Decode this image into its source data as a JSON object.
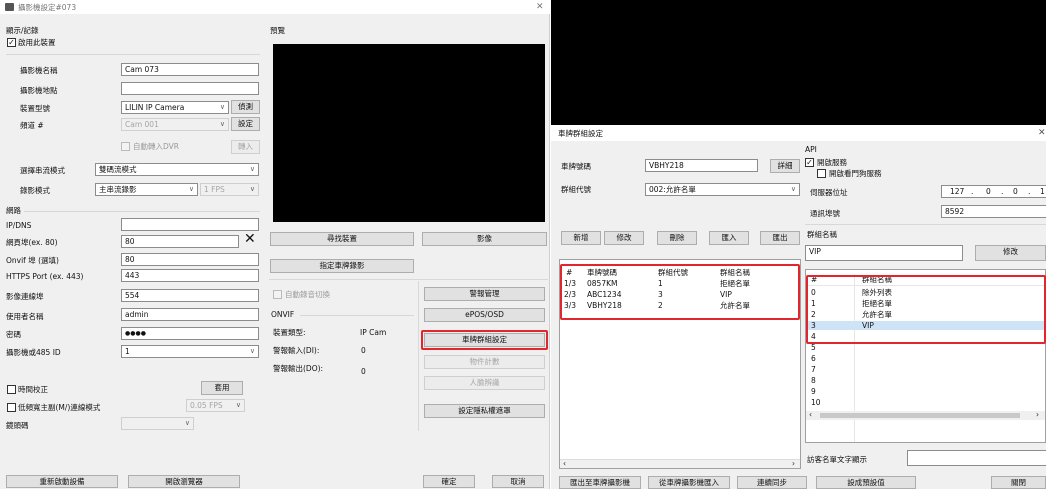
{
  "left_window": {
    "title": "攝影機設定#073",
    "display_record": {
      "group": "顯示/記錄",
      "enable_label": "啟用此裝置",
      "enable_checked": true
    },
    "fields": {
      "name_label": "攝影機名稱",
      "name_value": "Cam 073",
      "location_label": "攝影機地點",
      "location_value": "",
      "model_label": "裝置型號",
      "model_value": "LILIN IP Camera",
      "detect_button": "偵測",
      "channel_label": "頻道 #",
      "channel_value": "Cam 001",
      "setup_button": "設定",
      "auto_import_label": "自動轉入DVR",
      "import_button": "轉入",
      "stream_mode_label": "選擇串流模式",
      "stream_mode_value": "雙碼流模式",
      "record_mode_label": "錄影模式",
      "record_mode_value": "主串流錄影",
      "record_fps": "1 FPS"
    },
    "network": {
      "group": "網路",
      "ipdns_label": "IP/DNS",
      "ipdns_value": "",
      "webport_label": "網頁埠(ex. 80)",
      "webport_value": "80",
      "onvif_label": "Onvif 埠 (選填)",
      "onvif_value": "80",
      "https_label": "HTTPS Port (ex. 443)",
      "https_value": "443",
      "videoport_label": "影像連線埠",
      "videoport_value": "554",
      "user_label": "使用者名稱",
      "user_value": "admin",
      "pass_label": "密碼",
      "pass_value": "●●●●",
      "rs485_label": "攝影機或485 ID",
      "rs485_value": "1"
    },
    "bottom": {
      "time_sync_label": "時間校正",
      "apply_button": "套用",
      "low_bw_label": "低頻寬主副(M/)連線模式",
      "low_bw_fps": "0.05 FPS",
      "lens_label": "鏡頭碼",
      "lens_value": ""
    },
    "preview": {
      "group": "預覽",
      "find_device_button": "尋找裝置",
      "video_button": "影像",
      "set_plate_button": "指定車牌錄影"
    },
    "options": {
      "auto_record_switch": "自動錄音切換",
      "alarm_button": "警報管理",
      "onvif_label": "ONVIF",
      "epos_button": "ePOS/OSD",
      "device_type_label": "裝置類型:",
      "device_type_value": "IP Cam",
      "plate_group_button": "車牌群組設定",
      "alarm_in_label": "警報輸入(DI):",
      "alarm_in_value": "0",
      "counter_button": "物件計數",
      "alarm_out_label": "警報輸出(DO):",
      "alarm_out_value": "0",
      "face_button": "人臉辨識",
      "privacy_button": "設定隱私權遮罩"
    },
    "footer": {
      "restart_button": "重新啟動設備",
      "browser_button": "開啟瀏覽器",
      "ok_button": "確定",
      "cancel_button": "取消"
    }
  },
  "dialog": {
    "title": "車牌群組設定",
    "plate_label": "車牌號碼",
    "plate_value": "VBHY218",
    "detail_button": "詳細",
    "group_label": "群組代號",
    "group_value": "002:允許名單",
    "buttons": [
      "新增",
      "修改",
      "刪除",
      "匯入",
      "匯出"
    ],
    "table_headers": [
      "#",
      "車牌號碼",
      "群組代號",
      "群組名稱"
    ],
    "table_rows": [
      [
        "1/3",
        "0857KM",
        "1",
        "拒絕名單"
      ],
      [
        "2/3",
        "ABC1234",
        "3",
        "VIP"
      ],
      [
        "3/3",
        "VBHY218",
        "2",
        "允許名單"
      ]
    ],
    "api": {
      "group": "API",
      "enable_label": "開啟服務",
      "enable_checked": true,
      "gate_label": "開啟看門狗服務",
      "gate_checked": false,
      "server_label": "伺服器位址",
      "ip": [
        "127",
        "0",
        "0",
        "1"
      ],
      "port_label": "通訊埠號",
      "port_value": "8592"
    },
    "group_name_label": "群組名稱",
    "group_name_value": "VIP",
    "modify_button": "修改",
    "group_table_headers": [
      "#",
      "群組名稱"
    ],
    "group_rows": [
      [
        "0",
        "除外列表"
      ],
      [
        "1",
        "拒絕名單"
      ],
      [
        "2",
        "允許名單"
      ],
      [
        "3",
        "VIP"
      ],
      [
        "4",
        ""
      ],
      [
        "5",
        ""
      ],
      [
        "6",
        ""
      ],
      [
        "7",
        ""
      ],
      [
        "8",
        ""
      ],
      [
        "9",
        ""
      ],
      [
        "10",
        ""
      ]
    ],
    "visitor_label": "訪客名單文字顯示",
    "footer": {
      "export_button": "匯出至車牌攝影機",
      "import_button": "從車牌攝影機匯入",
      "sync_button": "連續同步",
      "default_button": "設成預設值",
      "close_button": "關閉"
    }
  },
  "colors": {
    "highlight": "#e2262d",
    "selected_row": "#cfe3f7",
    "preview_bg": "#000000"
  }
}
